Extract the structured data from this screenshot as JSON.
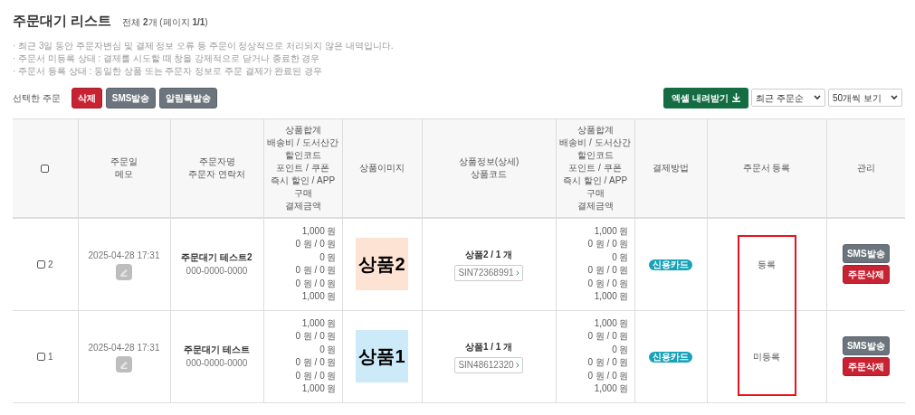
{
  "title": "주문대기 리스트",
  "summary": "전체 **2**개 (페이지 **1/1**)",
  "notes": [
    "· 최근 3일 동안 주문자변심 및 결제 정보 오류 등 주문이 정상적으로 처리되지 않은 내역입니다.",
    "· 주문서 미등록 상태 : 결제를 시도할 때 창을 강제적으로 닫거나 종료한 경우",
    "· 주문서 등록 상태 : 동일한 상품 또는 주문자 정보로 주문 결제가 완료된 경우"
  ],
  "bulk": {
    "label": "선택한 주문",
    "buttons": [
      {
        "label": "삭제",
        "kind": "danger"
      },
      {
        "label": "SMS발송",
        "kind": "secondary"
      },
      {
        "label": "알림톡발송",
        "kind": "secondary"
      }
    ]
  },
  "excel_button": "엑셀 내려받기",
  "sort_select": "최근 주문순",
  "page_size_select": "50개씩 보기",
  "table": {
    "select_all": {
      "checked": false
    },
    "columns": [
      {
        "kind": "check"
      },
      {
        "lines": [
          "주문일",
          "메모"
        ]
      },
      {
        "lines": [
          "주문자명",
          "주문자 연락처"
        ]
      },
      {
        "lines": [
          "상품합계",
          "배송비 / 도서산간",
          "할인코드",
          "포인트 / 쿠폰",
          "즉시 할인 / APP",
          "구매",
          "결제금액"
        ]
      },
      {
        "lines": [
          "상품이미지"
        ]
      },
      {
        "lines": [
          "상품정보(상세)",
          "상품코드"
        ]
      },
      {
        "lines": [
          "상품합계",
          "배송비 / 도서산간",
          "할인코드",
          "포인트 / 쿠폰",
          "즉시 할인 / APP",
          "구매",
          "결제금액"
        ]
      },
      {
        "lines": [
          "결제방법"
        ]
      },
      {
        "lines": [
          "주문서 등록"
        ],
        "highlighted": true
      },
      {
        "lines": [
          "관리"
        ]
      }
    ],
    "rows": [
      {
        "checked": false,
        "number": "2",
        "date": "2025-04-28 17:31",
        "name": "주문대기 테스트2",
        "phone": "000-0000-0000",
        "amounts": [
          "1,000 원",
          "0 원 / 0 원",
          "0 원",
          "0 원 / 0 원",
          "0 원 / 0 원",
          "1,000 원"
        ],
        "image_label": "상품2",
        "color": "#fde3d3",
        "product": "상품2 / 1 개",
        "code": "SIN72368991",
        "amounts_2": [
          "1,000 원",
          "0 원 / 0 원",
          "0 원",
          "0 원 / 0 원",
          "0 원 / 0 원",
          "1,000 원"
        ],
        "payment": "신용카드",
        "registration": "등록",
        "actions": [
          "SMS발송",
          "주문삭제"
        ]
      },
      {
        "checked": false,
        "number": "1",
        "date": "2025-04-28 17:31",
        "name": "주문대기 테스트",
        "phone": "000-0000-0000",
        "amounts": [
          "1,000 원",
          "0 원 / 0 원",
          "0 원",
          "0 원 / 0 원",
          "0 원 / 0 원",
          "1,000 원"
        ],
        "image_label": "상품1",
        "color": "#cdeaf8",
        "product": "상품1 / 1 개",
        "code": "SIN48612320",
        "amounts_2": [
          "1,000 원",
          "0 원 / 0 원",
          "0 원",
          "0 원 / 0 원",
          "0 원 / 0 원",
          "1,000 원"
        ],
        "payment": "신용카드",
        "registration": "미등록",
        "actions": [
          "SMS발송",
          "주문삭제"
        ]
      }
    ]
  }
}
